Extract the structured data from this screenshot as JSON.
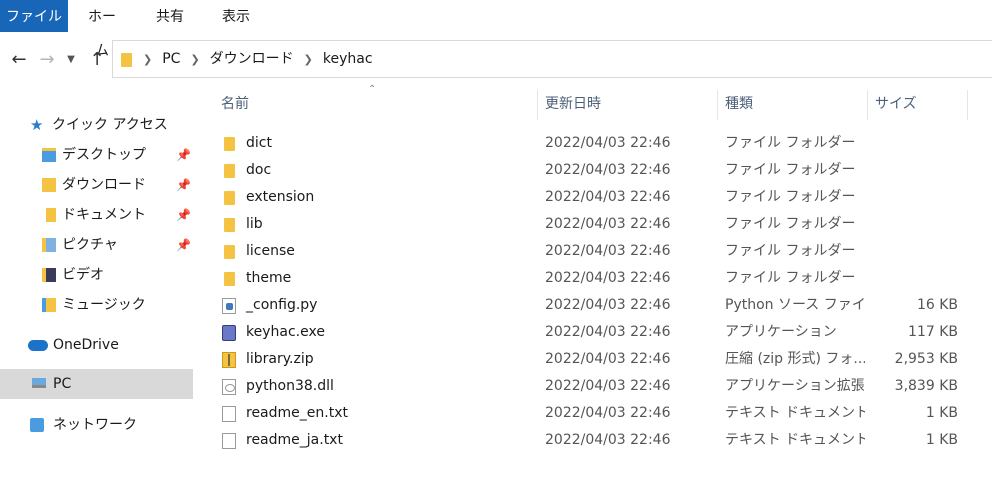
{
  "ribbon": {
    "tabs": [
      "ファイル",
      "ホーム",
      "共有",
      "表示"
    ]
  },
  "address": {
    "crumbs": [
      "PC",
      "ダウンロード",
      "keyhac"
    ]
  },
  "nav": {
    "quick_access": "クイック アクセス",
    "desktop": "デスクトップ",
    "downloads": "ダウンロード",
    "documents": "ドキュメント",
    "pictures": "ピクチャ",
    "videos": "ビデオ",
    "music": "ミュージック",
    "onedrive": "OneDrive",
    "pc": "PC",
    "network": "ネットワーク"
  },
  "columns": {
    "name": "名前",
    "date": "更新日時",
    "type": "種類",
    "size": "サイズ"
  },
  "files": [
    {
      "name": "dict",
      "date": "2022/04/03 22:46",
      "type": "ファイル フォルダー",
      "size": "",
      "icon": "folder-icon"
    },
    {
      "name": "doc",
      "date": "2022/04/03 22:46",
      "type": "ファイル フォルダー",
      "size": "",
      "icon": "folder-icon"
    },
    {
      "name": "extension",
      "date": "2022/04/03 22:46",
      "type": "ファイル フォルダー",
      "size": "",
      "icon": "folder-icon"
    },
    {
      "name": "lib",
      "date": "2022/04/03 22:46",
      "type": "ファイル フォルダー",
      "size": "",
      "icon": "folder-icon"
    },
    {
      "name": "license",
      "date": "2022/04/03 22:46",
      "type": "ファイル フォルダー",
      "size": "",
      "icon": "folder-icon"
    },
    {
      "name": "theme",
      "date": "2022/04/03 22:46",
      "type": "ファイル フォルダー",
      "size": "",
      "icon": "folder-icon"
    },
    {
      "name": "_config.py",
      "date": "2022/04/03 22:46",
      "type": "Python ソース ファイル",
      "size": "16 KB",
      "icon": "python-file-icon"
    },
    {
      "name": "keyhac.exe",
      "date": "2022/04/03 22:46",
      "type": "アプリケーション",
      "size": "117 KB",
      "icon": "application-icon"
    },
    {
      "name": "library.zip",
      "date": "2022/04/03 22:46",
      "type": "圧縮 (zip 形式) フォ...",
      "size": "2,953 KB",
      "icon": "zip-icon"
    },
    {
      "name": "python38.dll",
      "date": "2022/04/03 22:46",
      "type": "アプリケーション拡張",
      "size": "3,839 KB",
      "icon": "dll-icon"
    },
    {
      "name": "readme_en.txt",
      "date": "2022/04/03 22:46",
      "type": "テキスト ドキュメント",
      "size": "1 KB",
      "icon": "text-file-icon"
    },
    {
      "name": "readme_ja.txt",
      "date": "2022/04/03 22:46",
      "type": "テキスト ドキュメント",
      "size": "1 KB",
      "icon": "text-file-icon"
    }
  ],
  "colors": {
    "file_tab": "#1866b8",
    "folder": "#f5c343",
    "selected_nav": "#d9d9d9",
    "header_text": "#4c607a"
  }
}
